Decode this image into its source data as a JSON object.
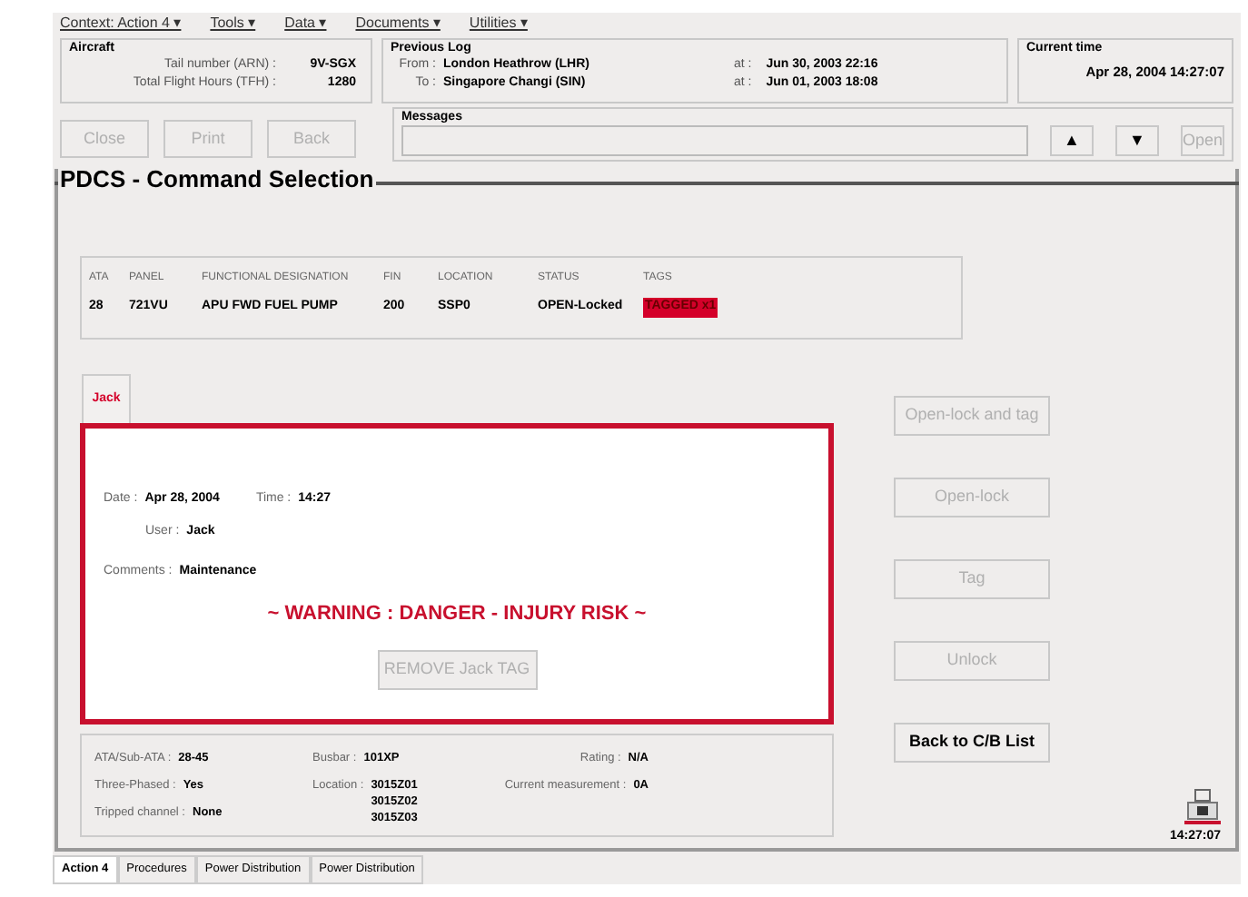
{
  "menu": [
    {
      "label": "Context: Action 4 ▾"
    },
    {
      "label": "Tools ▾"
    },
    {
      "label": "Data ▾"
    },
    {
      "label": "Documents ▾"
    },
    {
      "label": "Utilities ▾"
    }
  ],
  "aircraft": {
    "title": "Aircraft",
    "rows": [
      {
        "label": "Tail number (ARN) :",
        "value": "9V-SGX"
      },
      {
        "label": "Total Flight Hours (TFH) :",
        "value": "1280"
      }
    ]
  },
  "previous_log": {
    "title": "Previous Log",
    "rows": [
      {
        "label": "From :",
        "place": "London Heathrow (LHR)",
        "at": "at :",
        "time": "Jun 30, 2003 22:16"
      },
      {
        "label": "To :",
        "place": "Singapore Changi (SIN)",
        "at": "at :",
        "time": "Jun 01, 2003 18:08"
      }
    ]
  },
  "current_time": {
    "title": "Current time",
    "value": "Apr 28, 2004 14:27:07"
  },
  "toolbar_buttons": [
    {
      "label": "Close",
      "disabled": true
    },
    {
      "label": "Print",
      "disabled": true
    },
    {
      "label": "Back",
      "disabled": true
    }
  ],
  "messages": {
    "title": "Messages",
    "buttons": [
      {
        "label": "▲",
        "disabled": false
      },
      {
        "label": "▼",
        "disabled": false
      },
      {
        "label": "Open",
        "disabled": true
      }
    ]
  },
  "panel": {
    "title": "PDCS - Command Selection"
  },
  "table": {
    "columns": [
      "ATA",
      "PANEL",
      "FUNCTIONAL DESIGNATION",
      "FIN",
      "LOCATION",
      "STATUS",
      "TAGS"
    ],
    "row": [
      {
        "text": "28",
        "kind": "plain"
      },
      {
        "text": "721VU",
        "kind": "plain"
      },
      {
        "text": "APU FWD FUEL PUMP",
        "kind": "plain"
      },
      {
        "text": "200",
        "kind": "plain"
      },
      {
        "text": "SSP0",
        "kind": "plain"
      },
      {
        "text": "OPEN-Locked",
        "kind": "plain"
      },
      {
        "text": "TAGGED x1",
        "kind": "alert"
      }
    ]
  },
  "tag_tabs": [
    {
      "label": "Jack",
      "selected": true
    }
  ],
  "tag": {
    "date_label": "Date :",
    "date": "Apr 28, 2004",
    "time_label": "Time :",
    "time": "14:27",
    "user_label": "User :",
    "user": "Jack",
    "comments_label": "Comments :",
    "comments": "Maintenance",
    "warning": "~ WARNING : DANGER - INJURY RISK ~",
    "remove_button": {
      "label": "REMOVE Jack TAG",
      "disabled": true
    }
  },
  "details": [
    {
      "label": "ATA/Sub-ATA :",
      "value": "28-45"
    },
    {
      "label": "Three-Phased :",
      "value": "Yes"
    },
    {
      "label": "Tripped channel :",
      "value": "None"
    },
    {
      "label": "Busbar :",
      "value": "101XP"
    },
    {
      "label": "Location :",
      "value": "3015Z01\n3015Z02\n3015Z03"
    },
    {
      "label": "Rating :",
      "value": "N/A"
    },
    {
      "label": "Current measurement :",
      "value": "0A"
    }
  ],
  "actions": [
    {
      "label": "Open-lock and tag",
      "disabled": true
    },
    {
      "label": "Open-lock",
      "disabled": true
    },
    {
      "label": "Tag",
      "disabled": true
    },
    {
      "label": "Unlock",
      "disabled": true
    },
    {
      "label": "Back to C/B List",
      "disabled": false
    }
  ],
  "clock": "14:27:07",
  "bottom_tabs": [
    {
      "label": "Action 4",
      "selected": true
    },
    {
      "label": "Procedures",
      "selected": false
    },
    {
      "label": "Power Distribution",
      "selected": false
    },
    {
      "label": "Power Distribution",
      "selected": false
    }
  ]
}
